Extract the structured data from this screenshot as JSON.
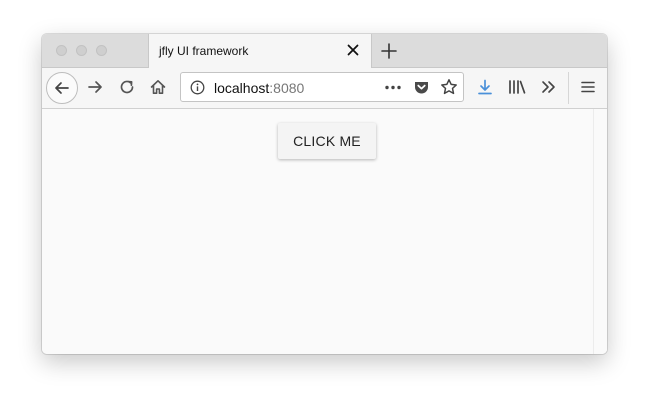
{
  "tab": {
    "title": "jfly UI framework"
  },
  "urlbar": {
    "host": "localhost",
    "port": ":8080"
  },
  "content": {
    "button_label": "CLICK ME"
  },
  "colors": {
    "download_accent": "#4a90d9",
    "window_bg": "#fafafa",
    "tabstrip_bg": "#dcdcdc"
  },
  "icons": [
    "close-window-icon",
    "minimize-window-icon",
    "maximize-window-icon",
    "close-tab-icon",
    "plus-icon",
    "back-arrow-icon",
    "forward-arrow-icon",
    "reload-icon",
    "home-icon",
    "info-icon",
    "more-dots-icon",
    "pocket-icon",
    "star-icon",
    "download-icon",
    "library-icon",
    "overflow-chevron-icon",
    "hamburger-menu-icon"
  ]
}
